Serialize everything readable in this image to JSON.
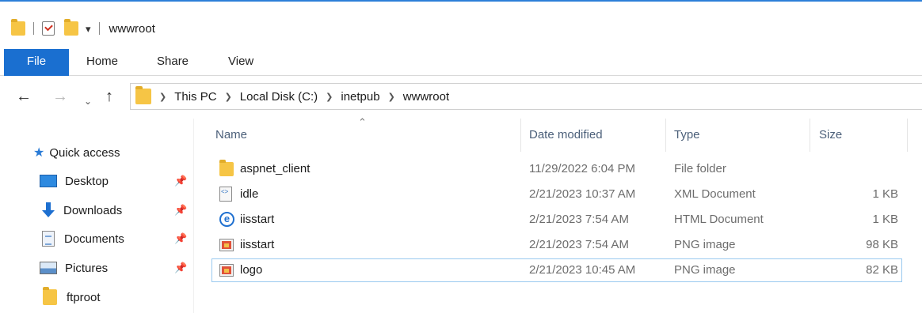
{
  "window": {
    "title": "wwwroot"
  },
  "ribbon": {
    "tabs": [
      {
        "label": "File"
      },
      {
        "label": "Home"
      },
      {
        "label": "Share"
      },
      {
        "label": "View"
      }
    ]
  },
  "address": {
    "breadcrumbs": [
      "This PC",
      "Local Disk (C:)",
      "inetpub",
      "wwwroot"
    ]
  },
  "sidebar": {
    "quick_access": "Quick access",
    "items": [
      {
        "label": "Desktop",
        "icon": "desktop-icon",
        "pinned": true
      },
      {
        "label": "Downloads",
        "icon": "downloads-icon",
        "pinned": true
      },
      {
        "label": "Documents",
        "icon": "documents-icon",
        "pinned": true
      },
      {
        "label": "Pictures",
        "icon": "pictures-icon",
        "pinned": true
      },
      {
        "label": "ftproot",
        "icon": "folder-icon",
        "pinned": false
      }
    ]
  },
  "file_list": {
    "columns": {
      "name": "Name",
      "date": "Date modified",
      "type": "Type",
      "size": "Size"
    },
    "sort_column": "Name",
    "files": [
      {
        "name": "aspnet_client",
        "date": "11/29/2022 6:04 PM",
        "type": "File folder",
        "size": "",
        "icon": "folder-icon"
      },
      {
        "name": "idle",
        "date": "2/21/2023 10:37 AM",
        "type": "XML Document",
        "size": "1 KB",
        "icon": "xml-file-icon"
      },
      {
        "name": "iisstart",
        "date": "2/21/2023 7:54 AM",
        "type": "HTML Document",
        "size": "1 KB",
        "icon": "html-file-icon"
      },
      {
        "name": "iisstart",
        "date": "2/21/2023 7:54 AM",
        "type": "PNG image",
        "size": "98 KB",
        "icon": "png-file-icon"
      },
      {
        "name": "logo",
        "date": "2/21/2023 10:45 AM",
        "type": "PNG image",
        "size": "82 KB",
        "icon": "png-file-icon",
        "selected": true
      }
    ]
  },
  "colors": {
    "accent": "#1a6fd0",
    "folder": "#f6c545",
    "selection_border": "#99c9ef"
  }
}
